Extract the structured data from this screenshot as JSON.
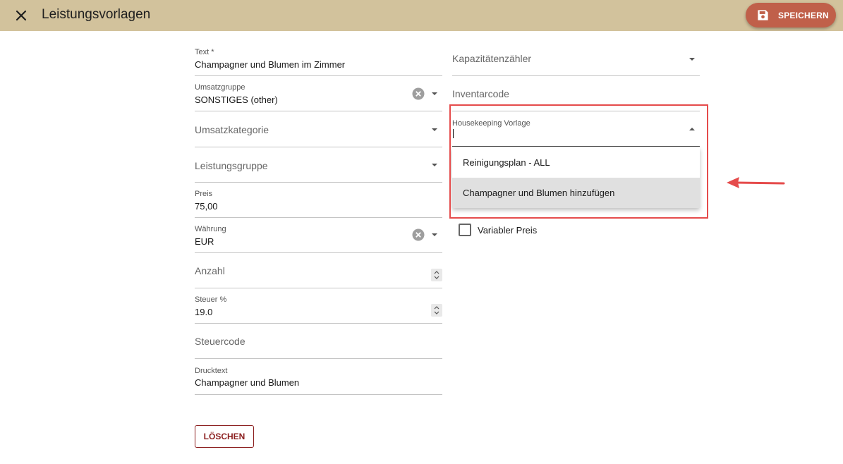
{
  "header": {
    "close_icon": "close-icon",
    "title": "Leistungsvorlagen",
    "save_label": "SPEICHERN",
    "save_icon": "save-icon",
    "colors": {
      "bar": "#d2c29c",
      "save_button": "#c0604a"
    }
  },
  "left_form": {
    "text_field": {
      "label": "Text *",
      "value": "Champagner und Blumen im Zimmer"
    },
    "revenue_group": {
      "label": "Umsatzgruppe",
      "value": "SONSTIGES (other)"
    },
    "revenue_category": {
      "placeholder": "Umsatzkategorie"
    },
    "service_group": {
      "placeholder": "Leistungsgruppe"
    },
    "price": {
      "label": "Preis",
      "value": "75,00"
    },
    "currency": {
      "label": "Währung",
      "value": "EUR"
    },
    "quantity": {
      "placeholder": "Anzahl"
    },
    "tax": {
      "label": "Steuer %",
      "value": "19.0"
    },
    "tax_code": {
      "placeholder": "Steuercode"
    },
    "print_text": {
      "label": "Drucktext",
      "value": "Champagner und Blumen"
    }
  },
  "right_form": {
    "capacity_counter": {
      "placeholder": "Kapazitätenzähler"
    },
    "inventory_code": {
      "placeholder": "Inventarcode"
    },
    "housekeeping": {
      "label": "Housekeeping Vorlage",
      "value": "",
      "options": [
        "Reinigungsplan - ALL",
        "Champagner und Blumen hinzufügen"
      ],
      "highlighted_option": "Champagner und Blumen hinzufügen"
    },
    "variable_price": {
      "label": "Variabler Preis",
      "checked": false
    }
  },
  "actions": {
    "delete_label": "LÖSCHEN"
  },
  "annotation": {
    "color": "#e54b4b"
  }
}
